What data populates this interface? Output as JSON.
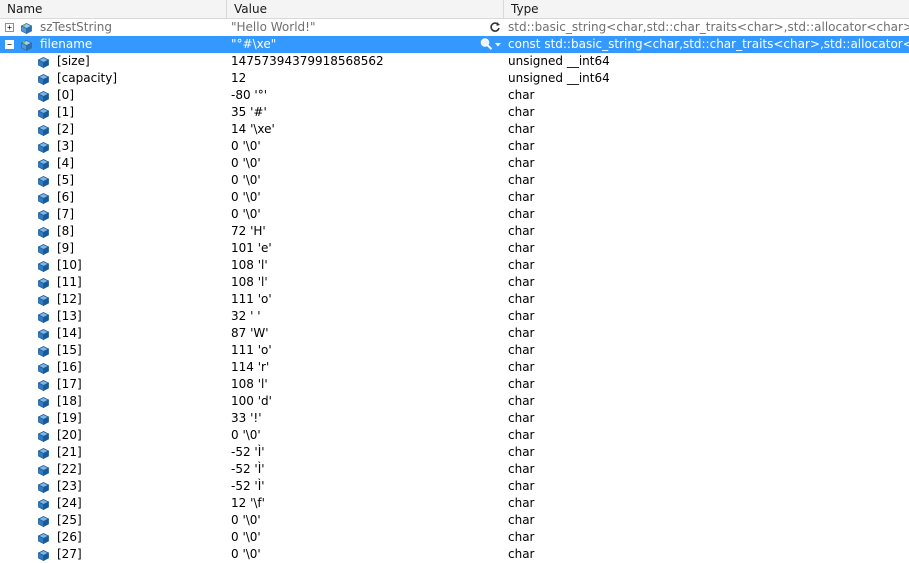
{
  "header": {
    "name": "Name",
    "value": "Value",
    "type": "Type"
  },
  "rows": [
    {
      "name": "szTestString",
      "value": "\"Hello World!\"",
      "type": "std::basic_string<char,std::char_traits<char>,std::allocator<char> >",
      "icon": "object-icon",
      "expander": "+",
      "state": "stale"
    },
    {
      "name": "filename",
      "value": "\"°#\\xe\"",
      "type": "const std::basic_string<char,std::char_traits<char>,std::allocator<char> > &",
      "icon": "object-icon",
      "expander": "−",
      "state": "selected"
    },
    {
      "name": "[size]",
      "value": "14757394379918568562",
      "type": "unsigned __int64",
      "icon": "field-icon"
    },
    {
      "name": "[capacity]",
      "value": "12",
      "type": "unsigned __int64",
      "icon": "field-icon"
    },
    {
      "name": "[0]",
      "value": "-80 '°'",
      "type": "char",
      "icon": "field-icon"
    },
    {
      "name": "[1]",
      "value": "35 '#'",
      "type": "char",
      "icon": "field-icon"
    },
    {
      "name": "[2]",
      "value": "14 '\\xe'",
      "type": "char",
      "icon": "field-icon"
    },
    {
      "name": "[3]",
      "value": "0 '\\0'",
      "type": "char",
      "icon": "field-icon"
    },
    {
      "name": "[4]",
      "value": "0 '\\0'",
      "type": "char",
      "icon": "field-icon"
    },
    {
      "name": "[5]",
      "value": "0 '\\0'",
      "type": "char",
      "icon": "field-icon"
    },
    {
      "name": "[6]",
      "value": "0 '\\0'",
      "type": "char",
      "icon": "field-icon"
    },
    {
      "name": "[7]",
      "value": "0 '\\0'",
      "type": "char",
      "icon": "field-icon"
    },
    {
      "name": "[8]",
      "value": "72 'H'",
      "type": "char",
      "icon": "field-icon"
    },
    {
      "name": "[9]",
      "value": "101 'e'",
      "type": "char",
      "icon": "field-icon"
    },
    {
      "name": "[10]",
      "value": "108 'l'",
      "type": "char",
      "icon": "field-icon"
    },
    {
      "name": "[11]",
      "value": "108 'l'",
      "type": "char",
      "icon": "field-icon"
    },
    {
      "name": "[12]",
      "value": "111 'o'",
      "type": "char",
      "icon": "field-icon"
    },
    {
      "name": "[13]",
      "value": "32 ' '",
      "type": "char",
      "icon": "field-icon"
    },
    {
      "name": "[14]",
      "value": "87 'W'",
      "type": "char",
      "icon": "field-icon"
    },
    {
      "name": "[15]",
      "value": "111 'o'",
      "type": "char",
      "icon": "field-icon"
    },
    {
      "name": "[16]",
      "value": "114 'r'",
      "type": "char",
      "icon": "field-icon"
    },
    {
      "name": "[17]",
      "value": "108 'l'",
      "type": "char",
      "icon": "field-icon"
    },
    {
      "name": "[18]",
      "value": "100 'd'",
      "type": "char",
      "icon": "field-icon"
    },
    {
      "name": "[19]",
      "value": "33 '!'",
      "type": "char",
      "icon": "field-icon"
    },
    {
      "name": "[20]",
      "value": "0 '\\0'",
      "type": "char",
      "icon": "field-icon"
    },
    {
      "name": "[21]",
      "value": "-52 'Ì'",
      "type": "char",
      "icon": "field-icon"
    },
    {
      "name": "[22]",
      "value": "-52 'Ì'",
      "type": "char",
      "icon": "field-icon"
    },
    {
      "name": "[23]",
      "value": "-52 'Ì'",
      "type": "char",
      "icon": "field-icon"
    },
    {
      "name": "[24]",
      "value": "12 '\\f'",
      "type": "char",
      "icon": "field-icon"
    },
    {
      "name": "[25]",
      "value": "0 '\\0'",
      "type": "char",
      "icon": "field-icon"
    },
    {
      "name": "[26]",
      "value": "0 '\\0'",
      "type": "char",
      "icon": "field-icon"
    },
    {
      "name": "[27]",
      "value": "0 '\\0'",
      "type": "char",
      "icon": "field-icon"
    }
  ],
  "icons": {
    "stale_row": "refresh-icon",
    "selected_row": [
      "magnifier-icon",
      "chevron-down-icon"
    ]
  },
  "colors": {
    "selection": "#3399ff",
    "stale_text": "#6f6f6f",
    "field_icon": "#1f6fb8"
  }
}
